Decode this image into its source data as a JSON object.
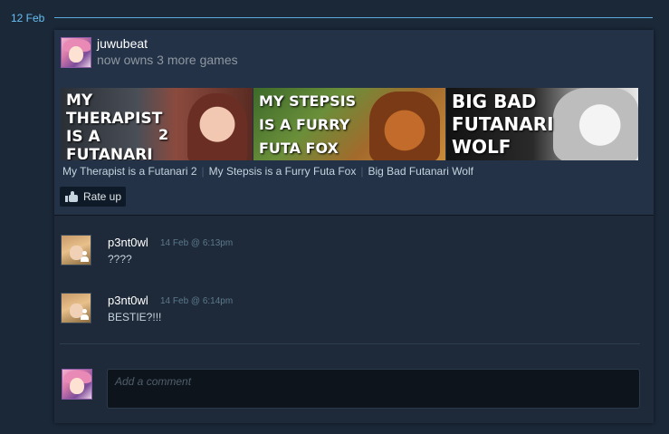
{
  "date_header": {
    "label": "12 Feb"
  },
  "post": {
    "username": "juwubeat",
    "action": "now owns 3 more games",
    "games": [
      {
        "banner_text": "MY\nTHERAPIST\nIS A\nFUTANARI",
        "banner_extra": "2",
        "title": "My Therapist is a Futanari 2"
      },
      {
        "banner_text": "MY STEPSIS\nIS A FURRY\nFUTA FOX",
        "banner_extra": "",
        "title": "My Stepsis is a Furry Futa Fox"
      },
      {
        "banner_text": "BIG BAD\nFUTANARI\nWOLF",
        "banner_extra": "",
        "title": "Big Bad Futanari Wolf"
      }
    ],
    "separator": "|",
    "rate_up_label": "Rate up"
  },
  "comments": [
    {
      "username": "p3nt0wl",
      "timestamp": "14 Feb @ 6:13pm",
      "text": "????"
    },
    {
      "username": "p3nt0wl",
      "timestamp": "14 Feb @ 6:14pm",
      "text": "BESTIE?!!!"
    }
  ],
  "composer": {
    "placeholder": "Add a comment"
  },
  "colors": {
    "page_bg": "#1b2838",
    "card_bg": "#1e2a39",
    "accent": "#66c0f4",
    "muted_text": "#8f98a0",
    "timestamp": "#5b7a8c"
  },
  "icons": [
    "thumbs-up-icon",
    "friend-person-icon"
  ]
}
